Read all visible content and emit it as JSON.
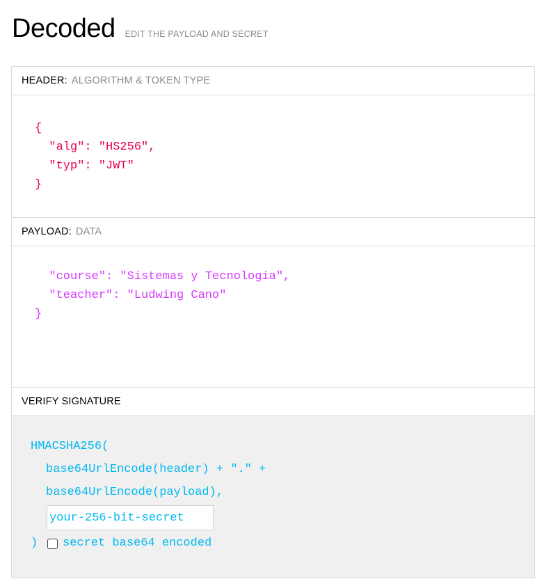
{
  "page": {
    "title": "Decoded",
    "subtitle": "EDIT THE PAYLOAD AND SECRET"
  },
  "header_section": {
    "label": "HEADER:",
    "sublabel": "ALGORITHM & TOKEN TYPE",
    "lines": [
      "{",
      "  \"alg\": \"HS256\",",
      "  \"typ\": \"JWT\"",
      "}"
    ]
  },
  "payload_section": {
    "label": "PAYLOAD:",
    "sublabel": "DATA",
    "lines": [
      "  \"course\": \"Sistemas y Tecnologia\",",
      "  \"teacher\": \"Ludwing Cano\"",
      "}"
    ]
  },
  "signature_section": {
    "label": "VERIFY SIGNATURE",
    "function": "HMACSHA256(",
    "line1": "base64UrlEncode(header) + \".\" +",
    "line2": "base64UrlEncode(payload),",
    "secret_value": "your-256-bit-secret",
    "close_paren": ")",
    "checkbox_label": "secret base64 encoded",
    "checkbox_checked": false
  },
  "colors": {
    "header_code": "#e6004e",
    "payload_code": "#d63aff",
    "signature_code": "#00b9f1"
  }
}
